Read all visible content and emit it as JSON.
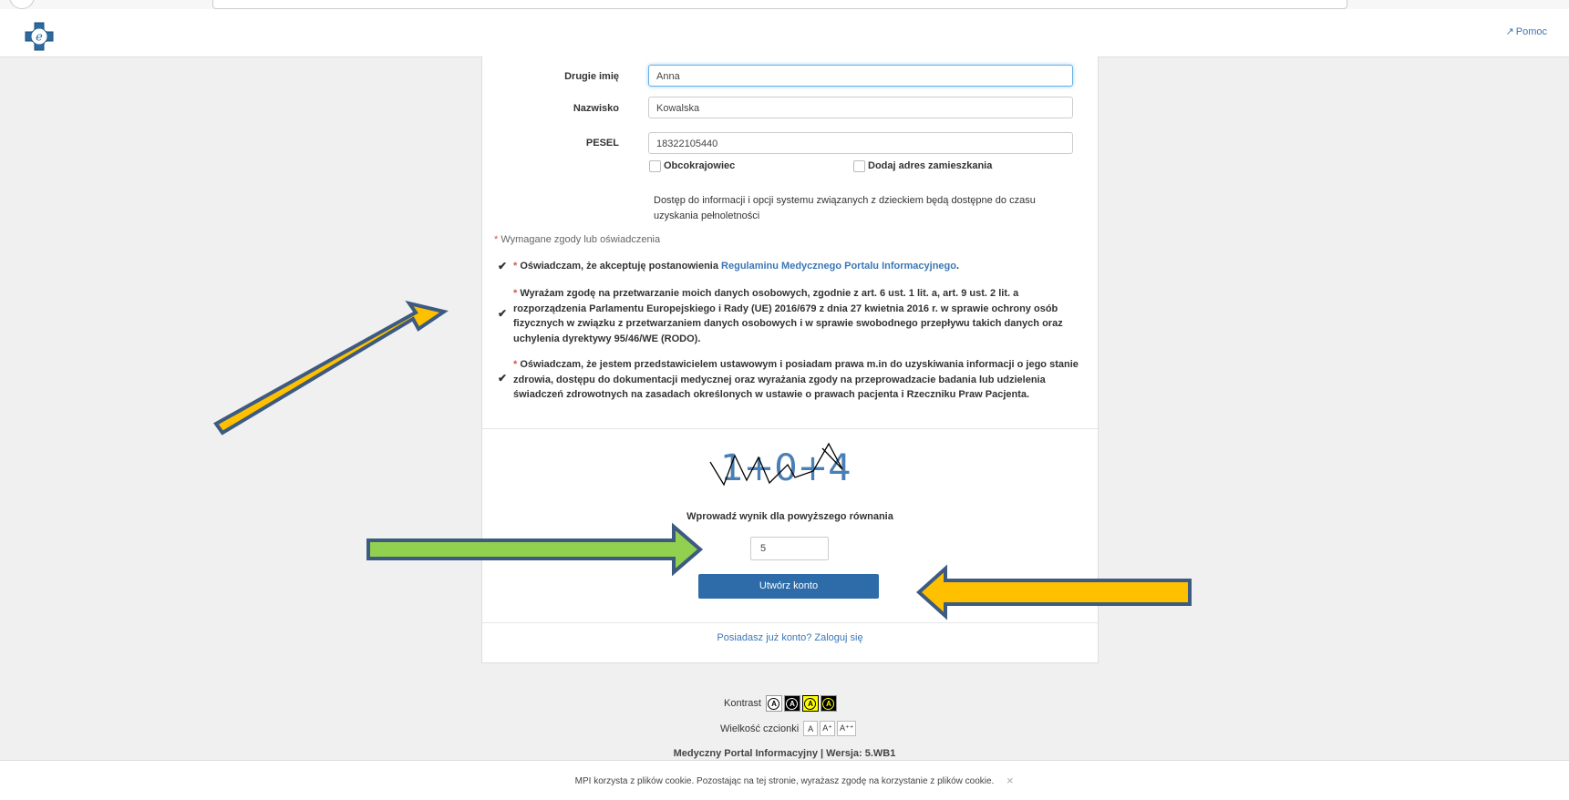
{
  "header": {
    "help_label": "Pomoc"
  },
  "form": {
    "middle_name": {
      "label": "Drugie imię",
      "value": "Anna"
    },
    "last_name": {
      "label": "Nazwisko",
      "value": "Kowalska"
    },
    "pesel": {
      "label": "PESEL",
      "value": "18322105440"
    },
    "foreigner_label": "Obcokrajowiec",
    "add_address_label": "Dodaj adres zamieszkania",
    "info_text": "Dostęp do informacji i opcji systemu związanych z dzieckiem będą dostępne do czasu uzyskania pełnoletności",
    "required_note": "Wymagane zgody lub oświadczenia",
    "consent1_text": "Oświadczam, że akceptuję postanowienia",
    "consent1_link": "Regulaminu Medycznego Portalu Informacyjnego",
    "consent2_text": "Wyrażam zgodę na przetwarzanie moich danych osobowych, zgodnie z art. 6 ust. 1 lit. a, art. 9 ust. 2 lit. a rozporządzenia Parlamentu Europejskiego i Rady (UE) 2016/679 z dnia 27 kwietnia 2016 r. w sprawie ochrony osób fizycznych w związku z przetwarzaniem danych osobowych i w sprawie swobodnego przepływu takich danych oraz uchylenia dyrektywy 95/46/WE (RODO).",
    "consent3_text": "Oświadczam, że jestem przedstawicielem ustawowym i posiadam prawa m.in do uzyskiwania informacji o jego stanie zdrowia, dostępu do dokumentacji medycznej oraz wyrażania zgody na przeprowadzacie badania lub udzielenia świadczeń zdrowotnych na zasadach określonych w ustawie o prawach pacjenta i Rzeczniku Praw Pacjenta.",
    "captcha_text": "1+0+4",
    "captcha_label": "Wprowadź wynik dla powyższego równania",
    "captcha_value": "5",
    "create_button": "Utwórz konto",
    "login_link": "Posiadasz już konto? Zaloguj się"
  },
  "footer": {
    "contrast_label": "Kontrast",
    "font_size_label": "Wielkość czcionki",
    "font_a": "A",
    "font_a_plus": "A⁺",
    "font_a_plusplus": "A⁺⁺",
    "version": "Medyczny Portal Informacyjny | Wersja: 5.WB1"
  },
  "cookie": {
    "text": "MPI korzysta z plików cookie. Pozostając na tej stronie, wyrażasz zgodę na korzystanie z plików cookie.",
    "close": "×"
  },
  "colors": {
    "primary": "#2d6ca8",
    "link": "#3a77b6",
    "arrow_yellow": "#ffc000",
    "arrow_green": "#92d050",
    "arrow_border": "#3d5a80"
  }
}
